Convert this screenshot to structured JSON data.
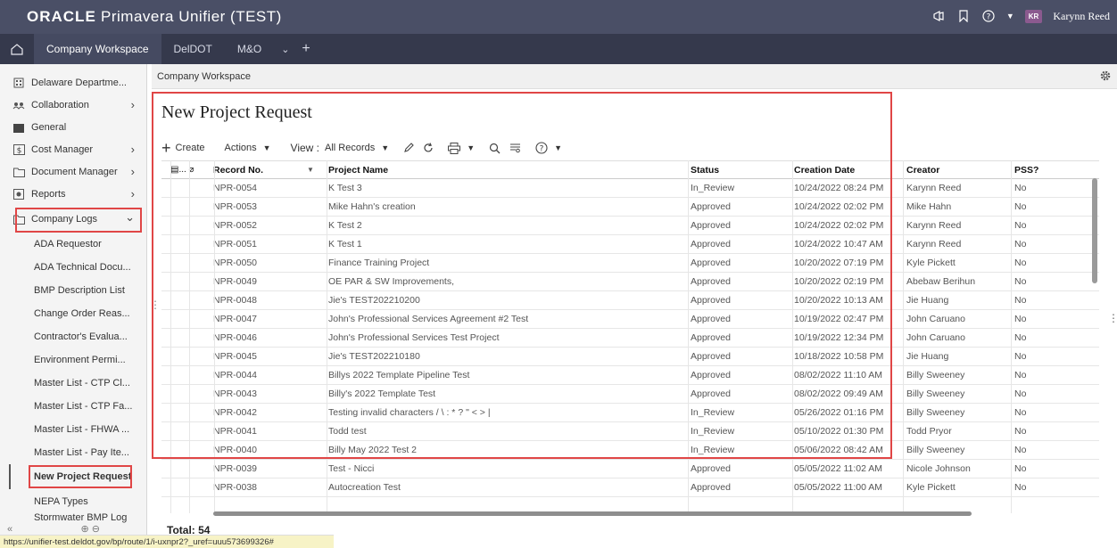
{
  "app": {
    "brand": "ORACLE",
    "title": "Primavera Unifier (TEST)"
  },
  "header": {
    "user_initials": "KR",
    "user_name": "Karynn Reed"
  },
  "tabs": [
    {
      "label": "Company Workspace"
    },
    {
      "label": "DelDOT"
    },
    {
      "label": "M&O"
    }
  ],
  "sidebar": {
    "items": [
      {
        "label": "Delaware Departme..."
      },
      {
        "label": "Collaboration"
      },
      {
        "label": "General"
      },
      {
        "label": "Cost Manager"
      },
      {
        "label": "Document Manager"
      },
      {
        "label": "Reports"
      },
      {
        "label": "Company Logs"
      }
    ],
    "subitems": [
      {
        "label": "ADA Requestor"
      },
      {
        "label": "ADA Technical Docu..."
      },
      {
        "label": "BMP Description List"
      },
      {
        "label": "Change Order Reas..."
      },
      {
        "label": "Contractor's Evalua..."
      },
      {
        "label": "Environment Permi..."
      },
      {
        "label": "Master List - CTP Cl..."
      },
      {
        "label": "Master List - CTP Fa..."
      },
      {
        "label": "Master List - FHWA ..."
      },
      {
        "label": "Master List - Pay Ite..."
      },
      {
        "label": "New Project Request"
      },
      {
        "label": "NEPA Types"
      },
      {
        "label": "Stormwater BMP Log"
      }
    ]
  },
  "breadcrumb": "Company Workspace",
  "page_title": "New Project Request",
  "toolbar": {
    "create": "Create",
    "actions": "Actions",
    "view_label": "View :",
    "view_value": "All Records"
  },
  "table": {
    "columns": {
      "icons": "▤... ⌀",
      "record": "Record No.",
      "name": "Project Name",
      "status": "Status",
      "date": "Creation Date",
      "creator": "Creator",
      "pss": "PSS?"
    },
    "rows": [
      {
        "record": "NPR-0054",
        "name": "K Test 3",
        "status": "In_Review",
        "date": "10/24/2022 08:24 PM",
        "creator": "Karynn Reed",
        "pss": "No"
      },
      {
        "record": "NPR-0053",
        "name": "Mike Hahn's creation",
        "status": "Approved",
        "date": "10/24/2022 02:02 PM",
        "creator": "Mike Hahn",
        "pss": "No"
      },
      {
        "record": "NPR-0052",
        "name": "K Test 2",
        "status": "Approved",
        "date": "10/24/2022 02:02 PM",
        "creator": "Karynn Reed",
        "pss": "No"
      },
      {
        "record": "NPR-0051",
        "name": "K Test 1",
        "status": "Approved",
        "date": "10/24/2022 10:47 AM",
        "creator": "Karynn Reed",
        "pss": "No"
      },
      {
        "record": "NPR-0050",
        "name": "Finance Training Project",
        "status": "Approved",
        "date": "10/20/2022 07:19 PM",
        "creator": "Kyle Pickett",
        "pss": "No"
      },
      {
        "record": "NPR-0049",
        "name": "OE PAR & SW Improvements,",
        "status": "Approved",
        "date": "10/20/2022 02:19 PM",
        "creator": "Abebaw Berihun",
        "pss": "No"
      },
      {
        "record": "NPR-0048",
        "name": "Jie's TEST202210200",
        "status": "Approved",
        "date": "10/20/2022 10:13 AM",
        "creator": "Jie Huang",
        "pss": "No"
      },
      {
        "record": "NPR-0047",
        "name": "John's Professional Services Agreement #2 Test",
        "status": "Approved",
        "date": "10/19/2022 02:47 PM",
        "creator": "John Caruano",
        "pss": "No"
      },
      {
        "record": "NPR-0046",
        "name": "John's Professional Services Test Project",
        "status": "Approved",
        "date": "10/19/2022 12:34 PM",
        "creator": "John Caruano",
        "pss": "No"
      },
      {
        "record": "NPR-0045",
        "name": "Jie's TEST202210180",
        "status": "Approved",
        "date": "10/18/2022 10:58 PM",
        "creator": "Jie Huang",
        "pss": "No"
      },
      {
        "record": "NPR-0044",
        "name": "Billys 2022 Template Pipeline Test",
        "status": "Approved",
        "date": "08/02/2022 11:10 AM",
        "creator": "Billy Sweeney",
        "pss": "No"
      },
      {
        "record": "NPR-0043",
        "name": "Billy's 2022 Template Test",
        "status": "Approved",
        "date": "08/02/2022 09:49 AM",
        "creator": "Billy Sweeney",
        "pss": "No"
      },
      {
        "record": "NPR-0042",
        "name": "Testing invalid characters / \\ : * ? \" < > |",
        "status": "In_Review",
        "date": "05/26/2022 01:16 PM",
        "creator": "Billy Sweeney",
        "pss": "No"
      },
      {
        "record": "NPR-0041",
        "name": "Todd test",
        "status": "In_Review",
        "date": "05/10/2022 01:30 PM",
        "creator": "Todd Pryor",
        "pss": "No"
      },
      {
        "record": "NPR-0040",
        "name": "Billy May 2022 Test 2",
        "status": "In_Review",
        "date": "05/06/2022 08:42 AM",
        "creator": "Billy Sweeney",
        "pss": "No"
      },
      {
        "record": "NPR-0039",
        "name": "Test - Nicci",
        "status": "Approved",
        "date": "05/05/2022 11:02 AM",
        "creator": "Nicole Johnson",
        "pss": "No"
      },
      {
        "record": "NPR-0038",
        "name": "Autocreation Test",
        "status": "Approved",
        "date": "05/05/2022 11:00 AM",
        "creator": "Kyle Pickett",
        "pss": "No"
      }
    ]
  },
  "total": "Total: 54",
  "status_url": "https://unifier-test.deldot.gov/bp/route/1/i-uxnpr2?_uref=uuu573699326#",
  "colors": {
    "highlight": "#e04646",
    "topbar": "#4a4f66",
    "tabbar": "#35394c"
  }
}
